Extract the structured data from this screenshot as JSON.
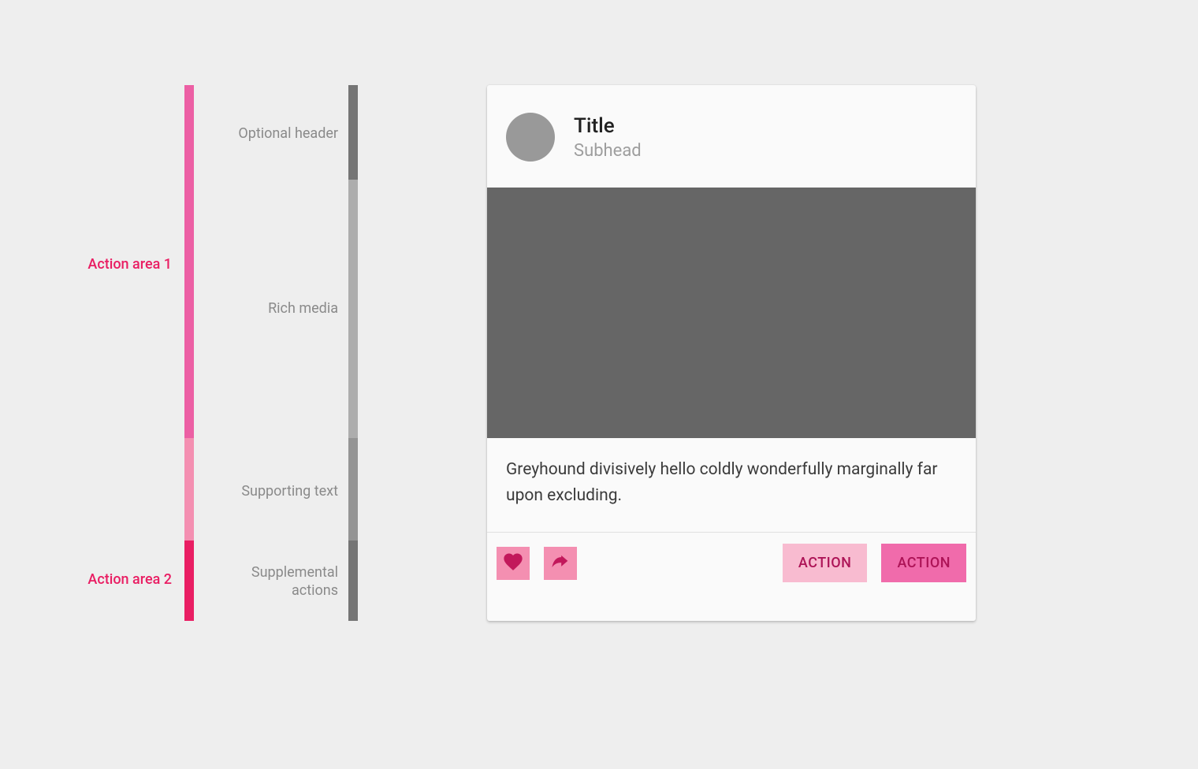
{
  "annotations": {
    "area1": "Action area 1",
    "area2": "Action area 2",
    "regions": {
      "header": "Optional header",
      "media": "Rich media",
      "supporting": "Supporting text",
      "supplemental": "Supplemental actions"
    }
  },
  "card": {
    "title": "Title",
    "subhead": "Subhead",
    "supporting_text": "Greyhound divisively hello coldly wonderfully marginally far upon excluding.",
    "actions": {
      "button1": "ACTION",
      "button2": "ACTION"
    }
  }
}
